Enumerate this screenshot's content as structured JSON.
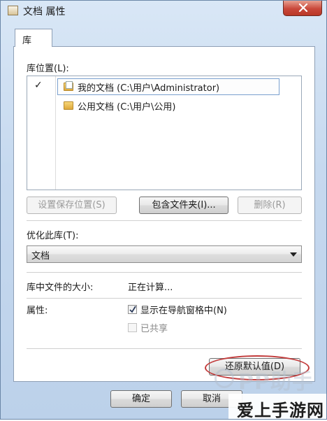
{
  "window": {
    "title": "文档 属性"
  },
  "tabs": [
    {
      "label": "库"
    }
  ],
  "library_locations": {
    "label": "库位置(L):",
    "items": [
      {
        "checked": true,
        "check_mark": "✓",
        "label": "我的文档 (C:\\用户\\Administrator)",
        "icon": "document-folder-icon"
      },
      {
        "checked": false,
        "check_mark": "",
        "label": "公用文档 (C:\\用户\\公用)",
        "icon": "folder-icon"
      }
    ],
    "buttons": {
      "set_save_location": "设置保存位置(S)",
      "include_folder": "包含文件夹(I)...",
      "remove": "删除(R)"
    }
  },
  "optimize": {
    "label": "优化此库(T):",
    "selected": "文档"
  },
  "size": {
    "label": "库中文件的大小:",
    "value": "正在计算..."
  },
  "attributes": {
    "label": "属性:",
    "show_in_nav": {
      "label": "显示在导航窗格中(N)",
      "checked": true
    },
    "shared": {
      "label": "已共享",
      "checked": false
    }
  },
  "restore_defaults": "还原默认值(D)",
  "footer": {
    "ok": "确定",
    "cancel": "取消"
  },
  "watermark": {
    "brand": "PP助手",
    "site": "爱上手游网"
  }
}
